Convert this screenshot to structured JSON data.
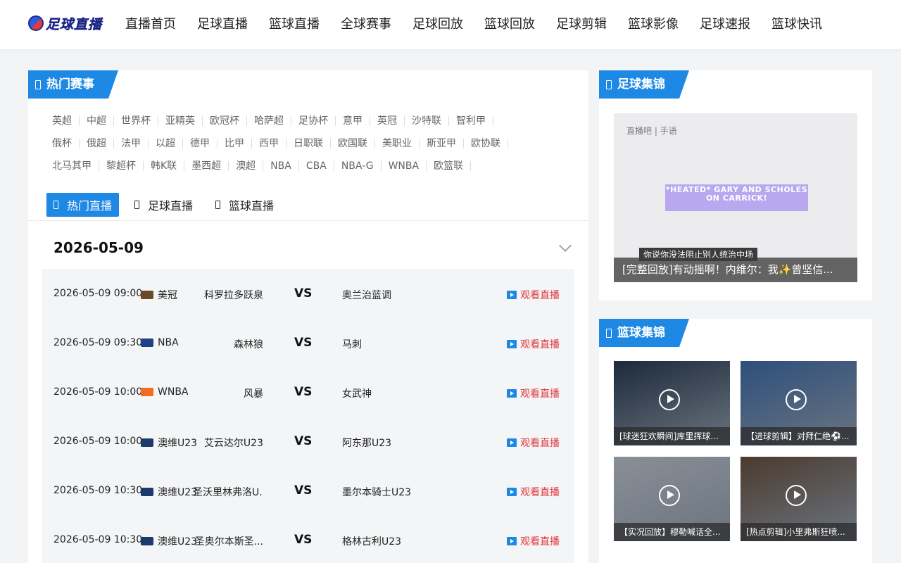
{
  "logo": {
    "text": "足球直播"
  },
  "nav": [
    "直播首页",
    "足球直播",
    "篮球直播",
    "全球赛事",
    "足球回放",
    "篮球回放",
    "足球剪辑",
    "篮球影像",
    "足球速报",
    "篮球快讯"
  ],
  "hot_events": {
    "title": "热门赛事",
    "tag_rows": [
      [
        "英超",
        "中超",
        "世界杯",
        "亚精英",
        "欧冠杯",
        "哈萨超",
        "足协杯",
        "意甲",
        "英冠",
        "沙特联",
        "智利甲"
      ],
      [
        "俄杯",
        "俄超",
        "法甲",
        "以超",
        "德甲",
        "比甲",
        "西甲",
        "日职联",
        "欧国联",
        "美职业",
        "斯亚甲",
        "欧协联"
      ],
      [
        "北马其甲",
        "黎超杯",
        "韩K联",
        "墨西超",
        "澳超",
        "NBA",
        "CBA",
        "NBA-G",
        "WNBA",
        "欧篮联"
      ]
    ]
  },
  "tabs": [
    {
      "label": "热门直播",
      "active": true
    },
    {
      "label": "足球直播",
      "active": false
    },
    {
      "label": "篮球直播",
      "active": false
    }
  ],
  "schedule": {
    "date": "2026-05-09",
    "watch_label": "观看直播",
    "vs_label": "VS",
    "matches": [
      {
        "time": "2026-05-09 09:00",
        "league": "美冠",
        "home": "科罗拉多跃泉",
        "away": "奥兰治蓝调",
        "league_color": "#6b4a2a"
      },
      {
        "time": "2026-05-09 09:30",
        "league": "NBA",
        "home": "森林狼",
        "away": "马刺",
        "league_color": "#1d428a"
      },
      {
        "time": "2026-05-09 10:00",
        "league": "WNBA",
        "home": "风暴",
        "away": "女武神",
        "league_color": "#f26b21"
      },
      {
        "time": "2026-05-09 10:00",
        "league": "澳维U23",
        "home": "艾云达尔U23",
        "away": "阿东那U23",
        "league_color": "#1b3a6b"
      },
      {
        "time": "2026-05-09 10:30",
        "league": "澳维U23",
        "home": "圣沃里林弗洛U...",
        "away": "墨尔本骑士U23",
        "league_color": "#1b3a6b"
      },
      {
        "time": "2026-05-09 10:30",
        "league": "澳维U23",
        "home": "圣奥尔本斯圣...",
        "away": "格林古利U23",
        "league_color": "#1b3a6b"
      }
    ]
  },
  "football_highlights": {
    "title": "足球集锦",
    "hero": {
      "caption": "[完整回放]有动摇啊！内维尔：我✨曾坚信...",
      "banner_text": "*HEATED* GARY AND SCHOLES ON CARRICK!",
      "subtitle": "你说你没法阻止别人统治中场",
      "top_text": "直播吧 | 手语"
    }
  },
  "basketball_highlights": {
    "title": "篮球集锦",
    "items": [
      {
        "caption": "[球迷狂欢瞬间]库里挥球...",
        "color": "#1c2a3a"
      },
      {
        "caption": "【进球剪辑】对拜仁绝⚽...",
        "color": "#2d4f7c"
      },
      {
        "caption": "【实况回放】穆勒喊话全...",
        "color": "#8a8f96"
      },
      {
        "caption": "[热点剪辑]小里弗斯狂喷...",
        "color": "#4b3b2e"
      }
    ]
  }
}
